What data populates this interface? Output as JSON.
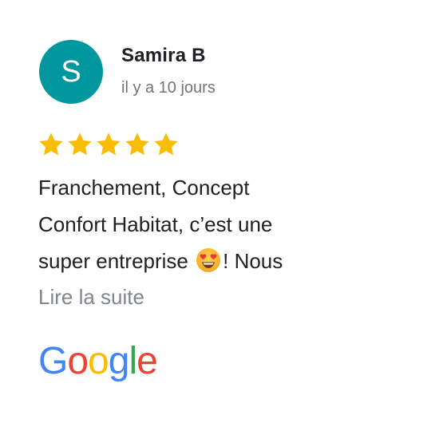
{
  "review": {
    "avatar_initial": "S",
    "avatar_color": "#00979f",
    "author": "Samira B",
    "date": "il y a 10 jours",
    "rating": 5,
    "rating_max": 5,
    "star_color": "#fbbc04",
    "text_lines": [
      "Franchement, Concept",
      "Confort Habitat, c’est une",
      "super entreprise"
    ],
    "text_after_emoji": "! Nous",
    "emoji": "heart-eyes-emoji",
    "read_more": "Lire la suite"
  },
  "brand": {
    "logo_text": "Google",
    "logo_colors": [
      "#4285f4",
      "#ea4335",
      "#fbbc05",
      "#4285f4",
      "#34a853",
      "#ea4335"
    ]
  }
}
